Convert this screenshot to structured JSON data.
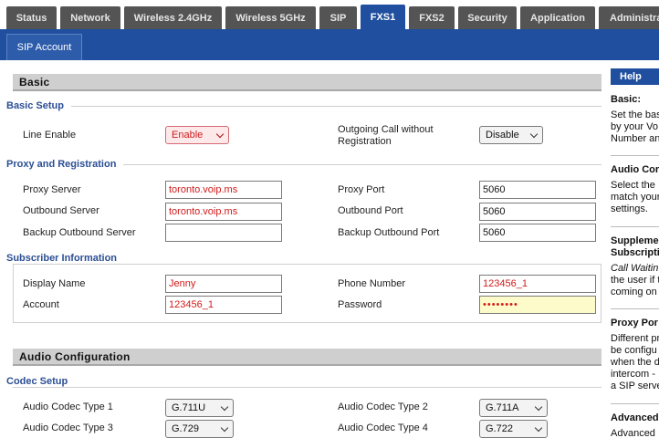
{
  "tabs": [
    {
      "label": "Status"
    },
    {
      "label": "Network"
    },
    {
      "label": "Wireless 2.4GHz"
    },
    {
      "label": "Wireless 5GHz"
    },
    {
      "label": "SIP"
    },
    {
      "label": "FXS1"
    },
    {
      "label": "FXS2"
    },
    {
      "label": "Security"
    },
    {
      "label": "Application"
    },
    {
      "label": "Administra"
    }
  ],
  "active_tab": "FXS1",
  "subtab": "SIP Account",
  "sections": {
    "basic": "Basic",
    "audio": "Audio Configuration"
  },
  "groups": {
    "basic_setup": "Basic Setup",
    "proxy": "Proxy and Registration",
    "subscriber": "Subscriber Information",
    "codec": "Codec Setup"
  },
  "fields": {
    "line_enable": {
      "label": "Line Enable",
      "value": "Enable"
    },
    "outgoing_call": {
      "label": "Outgoing Call without Registration",
      "value": "Disable"
    },
    "proxy_server": {
      "label": "Proxy Server",
      "value": "toronto.voip.ms"
    },
    "proxy_port": {
      "label": "Proxy Port",
      "value": "5060"
    },
    "outbound_server": {
      "label": "Outbound Server",
      "value": "toronto.voip.ms"
    },
    "outbound_port": {
      "label": "Outbound Port",
      "value": "5060"
    },
    "backup_outbound_server": {
      "label": "Backup Outbound Server",
      "value": ""
    },
    "backup_outbound_port": {
      "label": "Backup Outbound Port",
      "value": "5060"
    },
    "display_name": {
      "label": "Display Name",
      "value": "Jenny"
    },
    "phone_number": {
      "label": "Phone Number",
      "value": "123456_1"
    },
    "account": {
      "label": "Account",
      "value": "123456_1"
    },
    "password": {
      "label": "Password",
      "value": "••••••••"
    },
    "codec1": {
      "label": "Audio Codec Type 1",
      "value": "G.711U"
    },
    "codec2": {
      "label": "Audio Codec Type 2",
      "value": "G.711A"
    },
    "codec3": {
      "label": "Audio Codec Type 3",
      "value": "G.729"
    },
    "codec4": {
      "label": "Audio Codec Type 4",
      "value": "G.722"
    }
  },
  "help": {
    "header": "Help",
    "items": [
      {
        "title": "Basic:",
        "lines": [
          "Set the bas",
          "by your Vo",
          "Number an"
        ]
      },
      {
        "title": "Audio Cor",
        "lines": [
          "Select the",
          "match your",
          "settings."
        ]
      },
      {
        "title": "Suppleme",
        "title2": "Subscripti",
        "lines": [
          "Call Waitin",
          "the user if t",
          "coming on"
        ]
      },
      {
        "title": "Proxy Por",
        "lines": [
          "Different pr",
          "be configu",
          "when the d",
          "intercom -",
          "a SIP serve"
        ]
      },
      {
        "title": "Advanced",
        "lines": [
          "Advanced"
        ]
      }
    ]
  }
}
